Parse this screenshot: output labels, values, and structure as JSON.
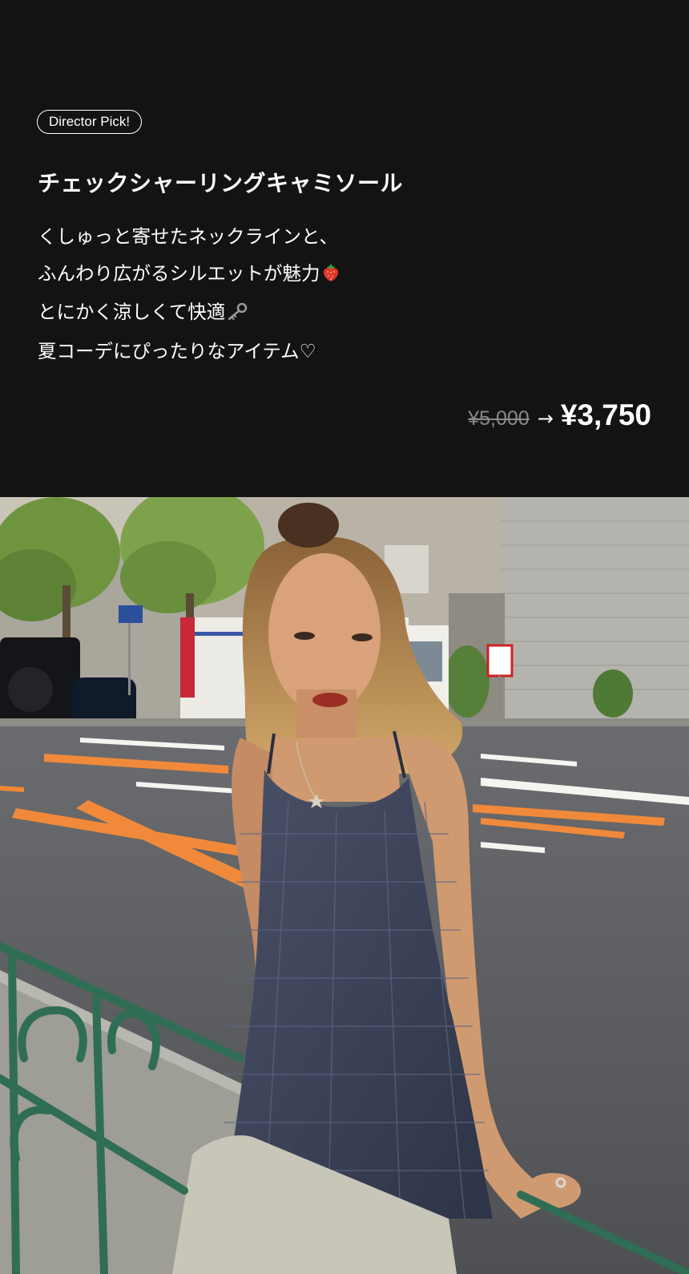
{
  "badge": "Director Pick!",
  "product": {
    "title": "チェックシャーリングキャミソール",
    "description_lines": [
      "くしゅっと寄せたネックラインと、",
      "ふんわり広がるシルエットが魅力",
      "とにかく涼しくて快適",
      "夏コーデにぴったりなアイテム♡"
    ],
    "emoji_icons": [
      "strawberry-icon",
      "key-icon"
    ]
  },
  "price": {
    "original": "¥5,000",
    "arrow": "→",
    "sale": "¥3,750"
  },
  "photo": {
    "sky_color": "#c9c4b8",
    "road_color": "#5c5e61",
    "road_marking_color": "#f08a3a",
    "railing_color": "#2f6e54",
    "top_color": "#3b4259",
    "hair_color": "#b98a52",
    "skin_color": "#d9a27b"
  }
}
